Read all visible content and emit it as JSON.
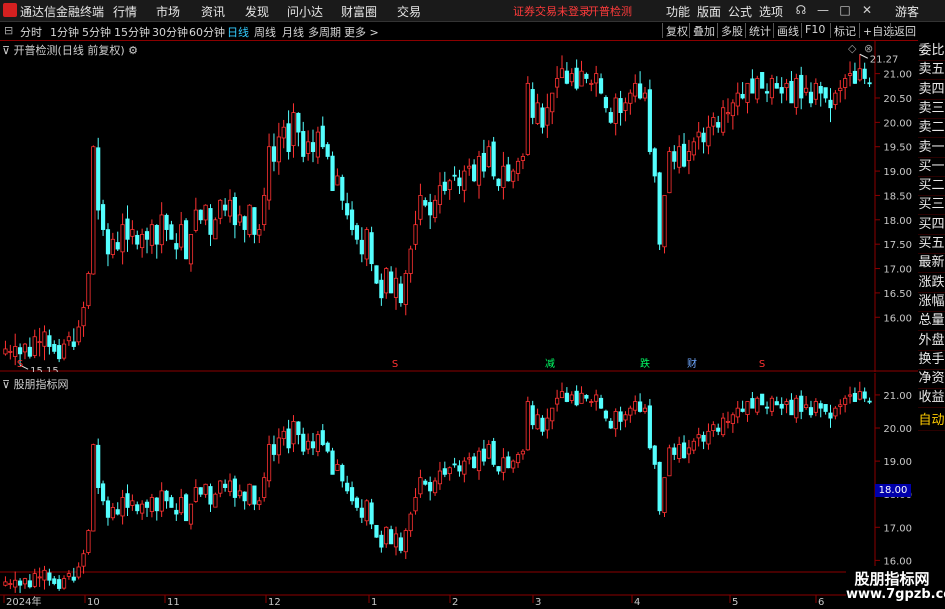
{
  "app": {
    "title": "通达信金融终端"
  },
  "menu": [
    "行情",
    "市场",
    "资讯",
    "发现",
    "问小达",
    "财富圈",
    "交易"
  ],
  "notice": {
    "login": "证券交易未登录",
    "indicator": "开普检测"
  },
  "right_menu": [
    "功能",
    "版面",
    "公式",
    "选项"
  ],
  "guest": "游客",
  "periods": [
    "分时",
    "1分钟",
    "5分钟",
    "15分钟",
    "30分钟",
    "60分钟",
    "日线",
    "周线",
    "月线",
    "多周期",
    "更多 >"
  ],
  "active_period": "日线",
  "right_tools": [
    "复权",
    "叠加",
    "多股",
    "统计",
    "画线",
    "F10",
    "标记",
    "+自选",
    "返回"
  ],
  "panel1": {
    "title": "开普检测(日线 前复权)",
    "high_label": "21.27",
    "low_label": "15.15",
    "y_ticks": [
      "21.00",
      "20.50",
      "20.00",
      "19.50",
      "19.00",
      "18.50",
      "18.00",
      "17.50",
      "17.00",
      "16.50",
      "16.00"
    ],
    "markers": [
      "S",
      "S",
      "减",
      "跌",
      "财",
      "S"
    ]
  },
  "panel2": {
    "title": "股朋指标网",
    "y_ticks": [
      "21.00",
      "20.00",
      "19.00",
      "18.00",
      "17.00",
      "16.00"
    ],
    "current": "18.00"
  },
  "x_labels": [
    "2024年",
    "10",
    "11",
    "12",
    "1",
    "2",
    "3",
    "4",
    "5",
    "6"
  ],
  "side": [
    "委比",
    "卖五",
    "卖四",
    "卖三",
    "卖二",
    "卖一",
    "买一",
    "买二",
    "买三",
    "买四",
    "买五",
    "最新",
    "涨跌",
    "涨幅",
    "总量",
    "外盘",
    "换手",
    "净资",
    "收益",
    "自动"
  ],
  "watermark": {
    "line1": "股朋指标网",
    "line2": "www.7gpzb.com"
  },
  "colors": {
    "up": "#ff3232",
    "down": "#54ffff",
    "grid": "#8b0000",
    "axis": "#c8c8c8"
  },
  "chart_data": {
    "type": "candlestick",
    "closes": [
      15.35,
      15.3,
      15.4,
      15.25,
      15.45,
      15.2,
      15.6,
      15.5,
      15.7,
      15.4,
      15.3,
      15.15,
      15.45,
      15.6,
      15.4,
      15.8,
      16.2,
      16.9,
      19.5,
      18.2,
      17.8,
      17.3,
      17.6,
      17.4,
      17.9,
      17.6,
      17.8,
      17.5,
      17.7,
      17.6,
      17.9,
      17.5,
      18.1,
      17.8,
      17.6,
      17.4,
      17.9,
      17.2,
      17.7,
      18.2,
      18.0,
      18.3,
      17.7,
      18.0,
      18.4,
      18.2,
      18.4,
      17.9,
      18.1,
      17.8,
      18.3,
      17.7,
      17.8,
      18.5,
      19.5,
      19.2,
      19.7,
      19.9,
      19.4,
      20.2,
      19.8,
      19.3,
      19.6,
      19.4,
      19.8,
      19.5,
      19.3,
      18.6,
      18.9,
      18.4,
      18.1,
      17.8,
      17.6,
      17.3,
      17.8,
      17.1,
      16.7,
      16.4,
      17.0,
      16.5,
      16.8,
      16.3,
      16.9,
      17.4,
      17.9,
      18.5,
      18.3,
      18.1,
      18.4,
      18.7,
      18.6,
      18.8,
      18.9,
      18.7,
      19.0,
      19.1,
      18.8,
      19.3,
      19.0,
      19.5,
      18.9,
      18.7,
      19.1,
      18.8,
      19.0,
      19.2,
      19.3,
      20.8,
      20.1,
      20.4,
      19.9,
      20.3,
      20.6,
      20.9,
      21.1,
      20.8,
      21.0,
      20.7,
      21.05,
      20.9,
      20.8,
      21.0,
      20.6,
      20.3,
      20.0,
      20.5,
      20.2,
      20.4,
      20.6,
      20.8,
      20.5,
      20.6,
      19.4,
      18.9,
      17.5,
      18.5,
      19.4,
      19.2,
      19.5,
      19.1,
      19.4,
      19.6,
      19.8,
      19.6,
      19.9,
      20.1,
      19.9,
      20.3,
      20.2,
      20.4,
      20.6,
      20.5,
      20.8,
      20.6,
      20.9,
      20.7,
      20.6,
      20.9,
      20.7,
      20.6,
      20.8,
      20.4,
      20.9,
      20.5,
      20.7,
      20.4,
      20.8,
      20.6,
      20.5,
      20.3,
      20.6,
      20.7,
      20.9,
      21.0,
      20.8,
      21.1,
      20.9,
      20.8
    ]
  }
}
